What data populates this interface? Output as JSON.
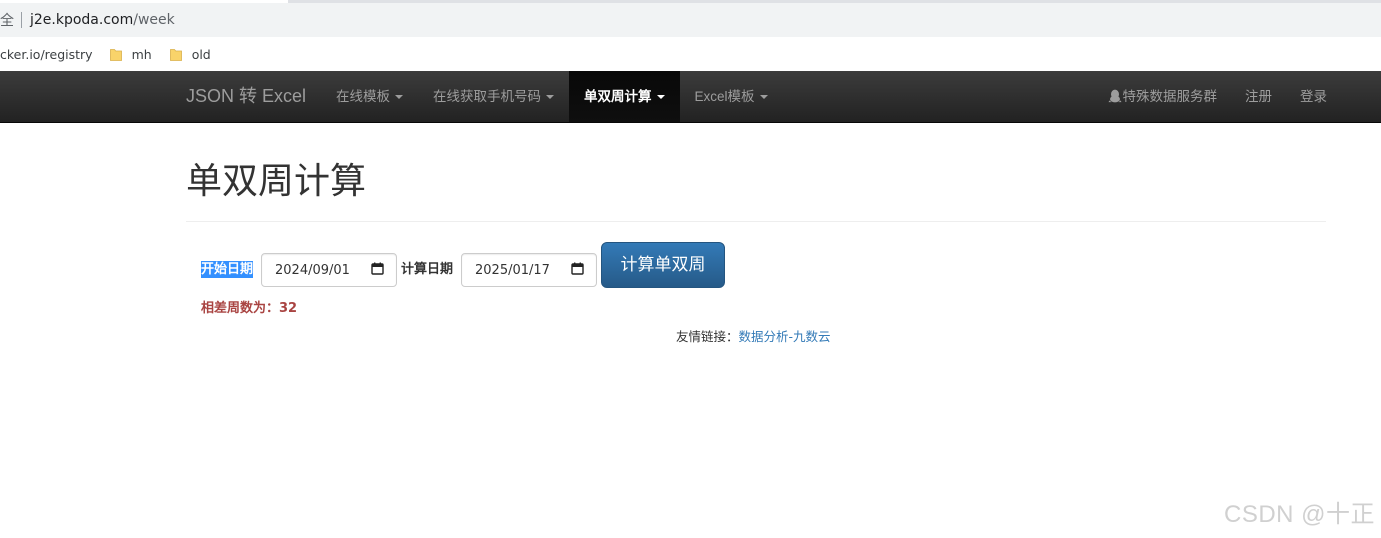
{
  "browser": {
    "secure_label": "全",
    "url_host": "j2e.kpoda.com",
    "url_path": "/week",
    "bookmarks": [
      {
        "label": "cker.io/registry"
      },
      {
        "label": "mh"
      },
      {
        "label": "old"
      }
    ]
  },
  "navbar": {
    "brand": "JSON 转 Excel",
    "items": [
      {
        "label": "在线模板",
        "active": false
      },
      {
        "label": "在线获取手机号码",
        "active": false
      },
      {
        "label": "单双周计算",
        "active": true
      },
      {
        "label": "Excel模板",
        "active": false
      }
    ],
    "right": {
      "qq_group": "特殊数据服务群",
      "register": "注册",
      "login": "登录"
    }
  },
  "main": {
    "title": "单双周计算",
    "form": {
      "start_label": "开始日期",
      "start_value": "2024/09/01",
      "end_label": "计算日期",
      "end_value": "2025/01/17",
      "submit_label": "计算单双周"
    },
    "result": "相差周数为：32",
    "friend_links": {
      "prefix": "友情链接：",
      "link_text": "数据分析-九数云"
    }
  },
  "watermark": "CSDN @十正",
  "colors": {
    "navbar_bg": "#222222",
    "button_primary": "#337ab7",
    "result_text": "#a94442",
    "link": "#337ab7",
    "selection": "#3390ff"
  }
}
